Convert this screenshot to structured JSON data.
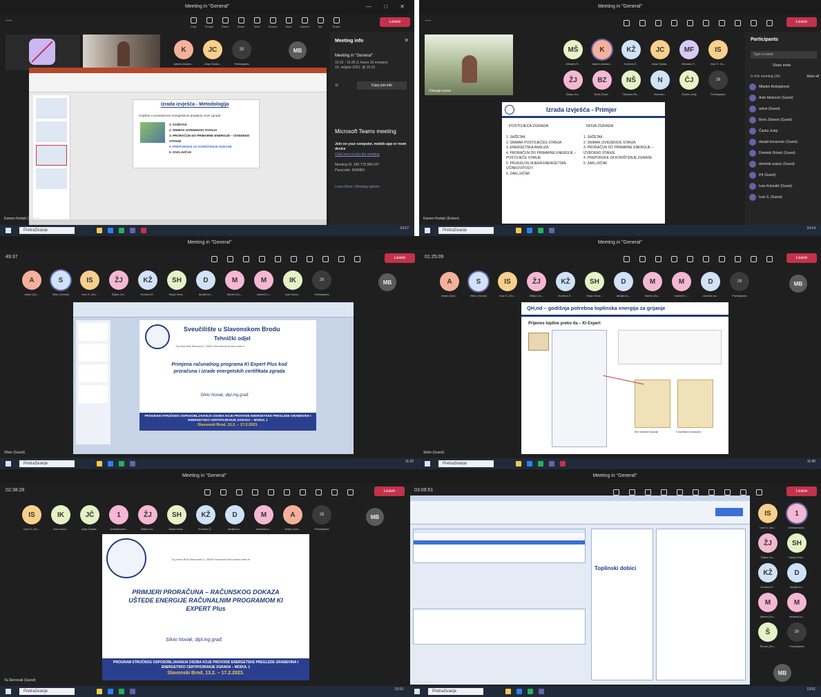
{
  "panels": [
    {
      "title": "Meeting in \"General\"",
      "timer": "----",
      "tools": [
        "Popravak",
        "Chat",
        "People",
        "Raise",
        "React",
        "View",
        "Rooms",
        "More"
      ],
      "right_tools": [
        "Camera",
        "Mic",
        "Share"
      ],
      "leave": "Leave",
      "participants": [
        {
          "initials": "K",
          "name": "kamen.kostan...",
          "color": "#f4b09b"
        },
        {
          "initials": "JC",
          "name": "Josip Čavka...",
          "color": "#f8d08c"
        },
        {
          "initials": "35",
          "name": "Participants",
          "color": "#3b3b3b"
        }
      ],
      "me": "MB",
      "slide_title": "Izrada izvješća - Metodologija",
      "slide_intro": "Izvješće o provedenom energetskom pregledu nove zgrade:",
      "slide_items": [
        "1. SAŽETAK",
        "2. SNIMAK IZVEDENOG STANJA",
        "3. PRORAČUN DO PRIMARNE ENERGIJE – IZVEDENO STANJE",
        "4. PREPORUKE ZA KORIŠTENJE ZGRADE",
        "5. ZAKLJUČAK"
      ],
      "info_title": "Meeting info",
      "info_meeting": "Meeting in \"General\"",
      "info_time": "15:15 - 15:30 (1 hours 15 minutes)",
      "info_date": "15. veljače 2021. @ 15:15",
      "copy_btn": "Copy join info",
      "teams_title": "Microsoft Teams meeting",
      "teams_join": "Join on your computer, mobile app or room device",
      "teams_link": "Click here to join the meeting",
      "teams_id": "Meeting ID: 346 778 980 647",
      "teams_pass": "Passcode: MJM8Dr",
      "teams_learn": "Learn More | Meeting options",
      "presenter": "Kamen Kortaić (Extern)",
      "search": "Pretraživanje",
      "clock": "14:27"
    },
    {
      "title": "Meeting in \"General\"",
      "timer": "----",
      "participants": [
        {
          "initials": "MŠ",
          "name": "Mihaela Š...",
          "color": "#e6f2c6"
        },
        {
          "initials": "K",
          "name": "kamen.kostan...",
          "color": "#f4b09b"
        },
        {
          "initials": "KŽ",
          "name": "Kortena Ž...",
          "color": "#cfe2f8"
        },
        {
          "initials": "JC",
          "name": "Josip Čavka...",
          "color": "#f8d08c"
        },
        {
          "initials": "MF",
          "name": "Miroslav F...",
          "color": "#d9c8f4"
        },
        {
          "initials": "IS",
          "name": "Ivan S. Gu...",
          "color": "#f8d08c"
        },
        {
          "initials": "ŽJ",
          "name": "Željka Jur...",
          "color": "#f4b7d4"
        },
        {
          "initials": "BZ",
          "name": "Boris Zlota...",
          "color": "#f4b7d4"
        },
        {
          "initials": "NŠ",
          "name": "Nikolina Ša...",
          "color": "#e6f2c6"
        },
        {
          "initials": "N",
          "name": "Nusmilu...",
          "color": "#cfe2f8"
        },
        {
          "initials": "ČJ",
          "name": "Čavka Josip",
          "color": "#e6f2c6"
        },
        {
          "initials": "26",
          "name": "Participants",
          "color": "#3b3b3b"
        }
      ],
      "change_scene": "Change scene",
      "slide_title": "Izrada izvješća - Primjer",
      "col_a": "POSTOJEĆA ZGRADA",
      "col_b": "NOVA ZGRADA",
      "a_items": [
        "1. SAŽETAK",
        "2. SNIMAK POSTOJEĆEG STANJA",
        "3. ENERGETSKA ANALIZA",
        "4. PRORAČUN DO PRIMARNE ENERGIJE – POSTOJEĆE STANJE",
        "5. PRIJEDLOG MJERA ENERGETSKE UČINKOVITOSTI",
        "6. ZAKLJUČAK"
      ],
      "b_items": [
        "1. SAŽETAK",
        "2. SNIMAK IZVEDENOG STANJA",
        "3. PRORAČUN DO PRIMARNE ENERGIJE – IZVEDENO STANJE",
        "4. PREPORUKE ZA KORIŠTENJE ZGRADE",
        "5. ZAKLJUČAK"
      ],
      "plist_title": "Participants",
      "plist_search": "Type a name",
      "plist_share": "Share invite",
      "plist_section": "In this meeting (26)",
      "plist_mute": "Mute all",
      "plist": [
        "Mladen Bošnjaković",
        "Ante Marković (Guest)",
        "antun (Guest)",
        "Boris Zlotović (Guest)",
        "Čavka Josip",
        "danijel.kovacevic (Guest)",
        "Dominik Drlović (Guest)",
        "dominik.cwacic (Guest)",
        "IHI (Guest)",
        "Ivan Kolundić (Guest)",
        "Ivan S. (Guest)"
      ],
      "presenter": "Kamen Kortaić (Extern)",
      "search": "Pretraživanje",
      "clock": "14:14"
    },
    {
      "title": "Meeting in \"General\"",
      "timer": "49:37",
      "participants": [
        {
          "initials": "A",
          "name": "antun (Gu...",
          "color": "#f4b09b"
        },
        {
          "initials": "S",
          "name": "Silvio (Guest)",
          "color": "#cfe2f8"
        },
        {
          "initials": "IS",
          "name": "Ivan S. (Gu...",
          "color": "#f8d08c"
        },
        {
          "initials": "ŽJ",
          "name": "Željka Jur...",
          "color": "#f4b7d4"
        },
        {
          "initials": "KŽ",
          "name": "Kortena Ž...",
          "color": "#cfe2f8"
        },
        {
          "initials": "SH",
          "name": "Sanja Hora...",
          "color": "#e6f2c6"
        },
        {
          "initials": "D",
          "name": "danijel.ko...",
          "color": "#cfe2f8"
        },
        {
          "initials": "M",
          "name": "Martin (Gu...",
          "color": "#f4b7d4"
        },
        {
          "initials": "M",
          "name": "maine21 (...",
          "color": "#f4b7d4"
        },
        {
          "initials": "IK",
          "name": "Ivan Kolun...",
          "color": "#e6f2c6"
        },
        {
          "initials": "26",
          "name": "Participants",
          "color": "#3b3b3b"
        }
      ],
      "slide_uni": "Sveučilište u Slavonskom Brodu",
      "slide_dept": "Tehnički odjel",
      "slide_addr": "Trg Ivane Brlić Mažuranić 2, 35000 Slavonski Brod    www.unisb.hr",
      "slide_main": "Primjena računalnog programa KI Expert Plus kod proračuna i izrade energetskih certifikata zgrada",
      "slide_author": "Silvio Novak, dipl.ing.građ.",
      "slide_footer": "PROGRAM STRUČNOG OSPOSOBLJAVANJA OSOBA KOJE PROVODE ENERGETSKE PREGLEDE GRAĐEVINA I ENERGETSKO CERTIFICIRANJE ZGRADA – MODUL 1",
      "slide_date": "Slavonski Brod, 13.2. – 17.2.2023.",
      "presenter": "Silvio (Guest)",
      "search": "Pretraživanje",
      "clock": "11:32"
    },
    {
      "title": "Meeting in \"General\"",
      "timer": "01:25:09",
      "participants": [
        {
          "initials": "A",
          "name": "antun (Gue...",
          "color": "#f4b09b"
        },
        {
          "initials": "S",
          "name": "Silvio (Guest)",
          "color": "#cfe2f8"
        },
        {
          "initials": "IS",
          "name": "Ivan S. (Gu...",
          "color": "#f8d08c"
        },
        {
          "initials": "ŽJ",
          "name": "Željka Jur...",
          "color": "#f4b7d4"
        },
        {
          "initials": "KŽ",
          "name": "Kortena Ž...",
          "color": "#cfe2f8"
        },
        {
          "initials": "SH",
          "name": "Sanja Hora...",
          "color": "#e6f2c6"
        },
        {
          "initials": "D",
          "name": "danijel.ko...",
          "color": "#cfe2f8"
        },
        {
          "initials": "M",
          "name": "Martin (Gu...",
          "color": "#f4b7d4"
        },
        {
          "initials": "M",
          "name": "maine21 (...",
          "color": "#f4b7d4"
        },
        {
          "initials": "D",
          "name": "dominik.cw...",
          "color": "#cfe2f8"
        },
        {
          "initials": "26",
          "name": "Participants",
          "color": "#3b3b3b"
        }
      ],
      "slide_title": "QH,nd – godišnja potrebna toplinska energija za grijanje",
      "slide_sub": "Prijenos topline preko tla – KI Expert",
      "slide_caption_a": "Bez toplinske izolacije",
      "slide_caption_b": "S toplinskom izolacijom",
      "presenter": "Silvio (Guest)",
      "search": "Pretraživanje",
      "clock": "11:40"
    },
    {
      "title": "Meeting in \"General\"",
      "timer": "02:38:28",
      "participants": [
        {
          "initials": "IS",
          "name": "Ivan S. (Gu...",
          "color": "#f8d08c"
        },
        {
          "initials": "IK",
          "name": "Ivan Kolun...",
          "color": "#e6f2c6"
        },
        {
          "initials": "JČ",
          "name": "Josip Čavka...",
          "color": "#e6f2c6"
        },
        {
          "initials": "1",
          "name": "1n9sdomacii...",
          "color": "#f4b7d4"
        },
        {
          "initials": "ŽJ",
          "name": "Željka Jur...",
          "color": "#f4b7d4"
        },
        {
          "initials": "SH",
          "name": "Sanja Hora...",
          "color": "#e6f2c6"
        },
        {
          "initials": "KŽ",
          "name": "Kortena Ž...",
          "color": "#cfe2f8"
        },
        {
          "initials": "D",
          "name": "danijel.ko...",
          "color": "#cfe2f8"
        },
        {
          "initials": "M",
          "name": "mihaela.ru...",
          "color": "#f4b7d4"
        },
        {
          "initials": "A",
          "name": "antun (Gue...",
          "color": "#f4b09b"
        },
        {
          "initials": "28",
          "name": "Participants",
          "color": "#3b3b3b"
        }
      ],
      "slide_addr": "Trg Ivane Brlić Mažuranić 2, 35000 Slavonski Brod    www.unisb.hr",
      "slide_main": "PRIMJERI PRORAČUNA – RAČUNSKOG DOKAZA UŠTEDE ENERGIJE RAČUNALNIM PROGRAMOM KI EXPERT Plus",
      "slide_author": "Silvio Novak, dipl.ing.građ.",
      "slide_footer": "PROGRAM STRUČNOG OSPOSOBLJAVANJA OSOBA KOJE PROVODE ENERGETSKE PREGLEDE GRAĐEVINA I ENERGETSKO CERTIFICIRANJE ZGRADA – MODUL 1",
      "slide_date": "Slavonski Brod, 13.2. – 17.2.2023.",
      "presenter": "Ta.Stenovak (Guest)",
      "search": "Pretraživanje",
      "clock": "13:10"
    },
    {
      "title": "Meeting in \"General\"",
      "timer": "03:09:51",
      "participants": [
        {
          "initials": "IS",
          "name": "Ivan S. (Gu...",
          "color": "#f8d08c"
        },
        {
          "initials": "1",
          "name": "1n9sdomacii...",
          "color": "#f4b7d4"
        },
        {
          "initials": "ŽJ",
          "name": "Željka Jur...",
          "color": "#f4b7d4"
        },
        {
          "initials": "SH",
          "name": "Sanja Hora...",
          "color": "#e6f2c6"
        },
        {
          "initials": "KŽ",
          "name": "Kortena Ž...",
          "color": "#cfe2f8"
        },
        {
          "initials": "D",
          "name": "danijel.ko...",
          "color": "#cfe2f8"
        },
        {
          "initials": "M",
          "name": "Martin (Gu...",
          "color": "#f4b7d4"
        },
        {
          "initials": "M",
          "name": "mihaela.ru...",
          "color": "#f4b7d4"
        },
        {
          "initials": "Š",
          "name": "Šimun (Gu...",
          "color": "#e6f2c6"
        },
        {
          "initials": "30",
          "name": "Participants",
          "color": "#3b3b3b"
        }
      ],
      "app_title": "Toplinski dobici",
      "presenter": "Silvio (Guest)",
      "search": "Pretraživanje",
      "clock": "13:51"
    }
  ],
  "colors": {
    "leave": "#c4314b",
    "accent": "#6264a7",
    "slide_blue": "#2b3f8f"
  }
}
